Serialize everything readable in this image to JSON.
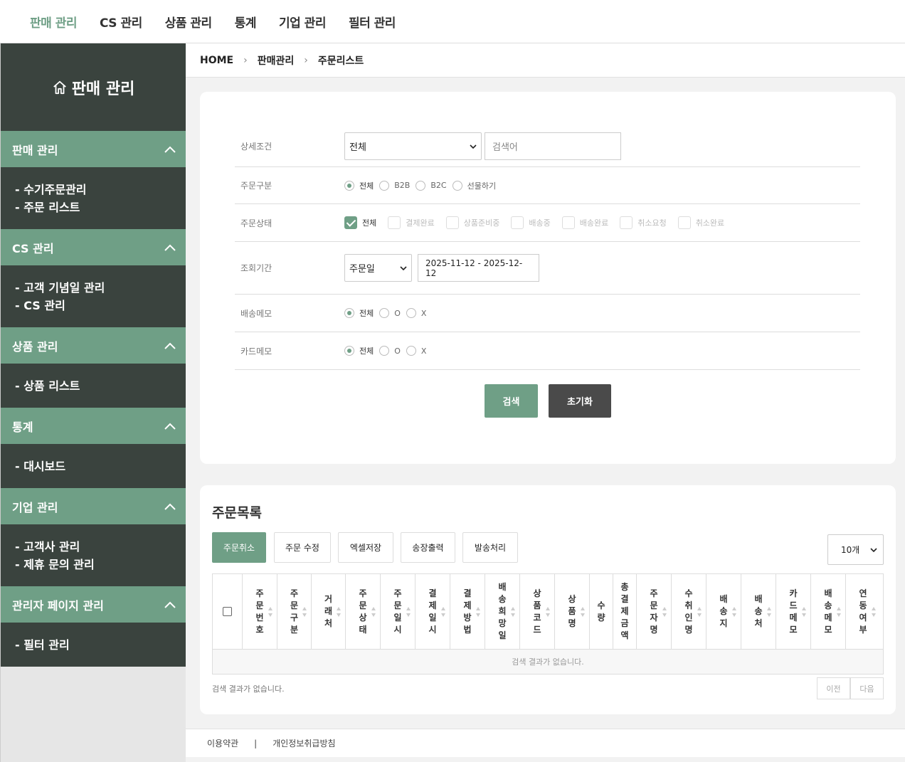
{
  "top_nav": [
    "판매 관리",
    "CS 관리",
    "상품 관리",
    "통계",
    "기업 관리",
    "필터 관리"
  ],
  "sidebar": {
    "title": "판매 관리",
    "sections": [
      {
        "title": "판매 관리",
        "items": [
          "- 수기주문관리",
          "- 주문 리스트"
        ]
      },
      {
        "title": "CS 관리",
        "items": [
          "- 고객 기념일 관리",
          "- CS 관리"
        ]
      },
      {
        "title": "상품 관리",
        "items": [
          "- 상품 리스트"
        ]
      },
      {
        "title": "통계",
        "items": [
          "- 대시보드"
        ]
      },
      {
        "title": "기업 관리",
        "items": [
          "- 고객사 관리",
          "- 제휴 문의 관리"
        ]
      },
      {
        "title": "관리자 페이지 관리",
        "items": [
          "- 필터 관리"
        ]
      }
    ]
  },
  "breadcrumb": [
    "HOME",
    "판매관리",
    "주문리스트"
  ],
  "filter": {
    "detail_label": "상세조건",
    "detail_select": "전체",
    "search_placeholder": "검색어",
    "order_type_label": "주문구분",
    "order_type_options": [
      "전체",
      "B2B",
      "B2C",
      "선물하기"
    ],
    "order_status_label": "주문상태",
    "order_status_options": [
      "전체",
      "결제완료",
      "상품준비중",
      "배송중",
      "배송완료",
      "취소요청",
      "취소완료"
    ],
    "period_label": "조회기간",
    "period_select": "주문일",
    "period_range": "2025-11-12 - 2025-12-12",
    "delivery_memo_label": "배송메모",
    "delivery_memo_options": [
      "전체",
      "O",
      "X"
    ],
    "card_memo_label": "카드메모",
    "card_memo_options": [
      "전체",
      "O",
      "X"
    ],
    "search_button": "검색",
    "reset_button": "초기화"
  },
  "list": {
    "title": "주문목록",
    "actions": [
      "주문취소",
      "주문 수정",
      "엑셀저장",
      "송장출력",
      "발송처리"
    ],
    "page_size": "10개",
    "columns": [
      "주문번호",
      "주문구분",
      "거래처",
      "주문상태",
      "주문일시",
      "결제일시",
      "결제방법",
      "배송희망일",
      "상품코드",
      "상품명",
      "수량",
      "총결제금액",
      "주문자명",
      "수취인명",
      "배송지",
      "배송처",
      "카드메모",
      "배송메모",
      "연동여부"
    ],
    "empty_text": "검색 결과가 없습니다.",
    "count_text": "검색 결과가 없습니다.",
    "prev": "이전",
    "next": "다음"
  },
  "footer": {
    "terms": "이용약관",
    "divider": "|",
    "privacy": "개인정보취급방침"
  },
  "colors": {
    "accent": "#6f9f86",
    "dark": "#3a433e",
    "reset": "#4a4a4a"
  }
}
